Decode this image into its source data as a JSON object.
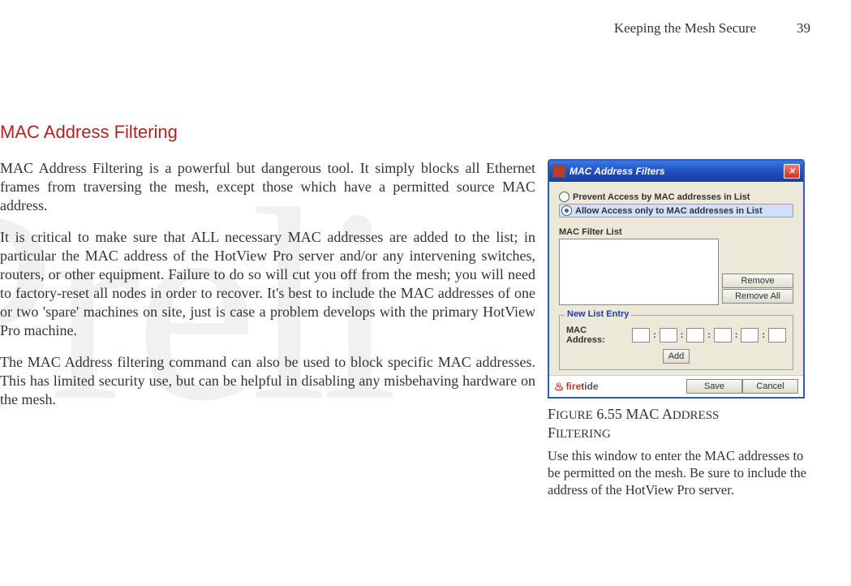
{
  "header": {
    "section": "Keeping the Mesh Secure",
    "page": "39"
  },
  "section_title": "MAC Address Filtering",
  "paragraphs": {
    "p1": "MAC Address Filtering is a powerful but dangerous tool. It simply blocks all Ethernet frames from traversing the mesh, except those which have a permitted source MAC address.",
    "p2": "It is critical to make sure that ALL necessary MAC addresses are added to the list; in particular the MAC address of the HotView Pro server and/or any intervening switches, routers, or other equipment. Failure to do so will cut you off from the mesh; you will need to factory-reset all nodes in order to recover. It's best to include the MAC addresses of one or two 'spare' machines on site, just is case a problem develops with the primary HotView Pro machine.",
    "p3": "The MAC Address filtering command can also be used to block specific MAC addresses. This has limited security use, but can be helpful in disabling any misbehaving hardware on the mesh."
  },
  "dialog": {
    "title": "MAC Address Filters",
    "radio_prevent": "Prevent Access by MAC addresses in List",
    "radio_allow": "Allow Access only to MAC addresses in List",
    "mac_filter_list_label": "MAC Filter List",
    "remove": "Remove",
    "remove_all": "Remove All",
    "new_entry_legend": "New List Entry",
    "mac_address_label": "MAC Address:",
    "add": "Add",
    "brand_fire": "fire",
    "brand_tide": "tide",
    "save": "Save",
    "cancel": "Cancel"
  },
  "figure": {
    "caption_prefix": "Figure 6.55 MAC A",
    "caption_rest": "ddress",
    "caption_line2": "Filtering",
    "description": "Use this window to enter the MAC addresses to be permitted on the mesh. Be sure to include the address of the HotView Pro server."
  },
  "watermark": "Preli"
}
